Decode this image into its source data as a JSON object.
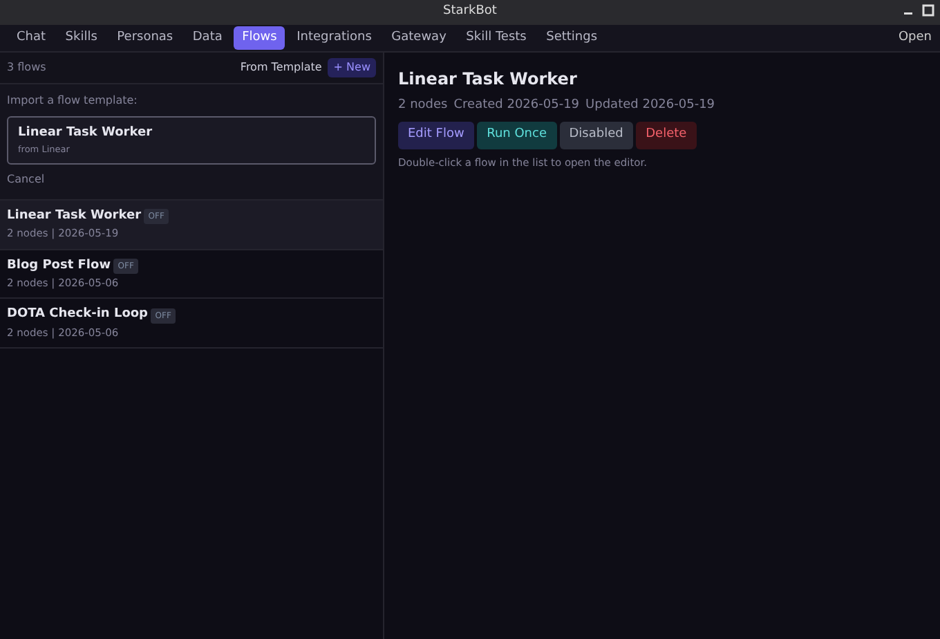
{
  "window": {
    "title": "StarkBot"
  },
  "tabs": [
    {
      "label": "Chat",
      "selected": false
    },
    {
      "label": "Skills",
      "selected": false
    },
    {
      "label": "Personas",
      "selected": false
    },
    {
      "label": "Data",
      "selected": false
    },
    {
      "label": "Flows",
      "selected": true
    },
    {
      "label": "Integrations",
      "selected": false
    },
    {
      "label": "Gateway",
      "selected": false
    },
    {
      "label": "Skill Tests",
      "selected": false
    },
    {
      "label": "Settings",
      "selected": false
    }
  ],
  "nav_right": "Open",
  "sidebar": {
    "count": "3 flows",
    "from_template": "From Template",
    "new_button": "+ New",
    "import": {
      "label": "Import a flow template:",
      "templates": [
        {
          "name": "Linear Task Worker",
          "source": "from Linear"
        }
      ],
      "cancel": "Cancel"
    },
    "flows": [
      {
        "name": "Linear Task Worker",
        "status": "OFF",
        "meta": "2 nodes | 2026-05-19",
        "selected": true
      },
      {
        "name": "Blog Post Flow",
        "status": "OFF",
        "meta": "2 nodes | 2026-05-06",
        "selected": false
      },
      {
        "name": "DOTA Check-in Loop",
        "status": "OFF",
        "meta": "2 nodes | 2026-05-06",
        "selected": false
      }
    ]
  },
  "detail": {
    "title": "Linear Task Worker",
    "nodes": "2 nodes",
    "created": "Created 2026-05-19",
    "updated": "Updated 2026-05-19",
    "buttons": [
      {
        "label": "Edit Flow",
        "kind": "edit"
      },
      {
        "label": "Run Once",
        "kind": "run"
      },
      {
        "label": "Disabled",
        "kind": "toggle"
      },
      {
        "label": "Delete",
        "kind": "delete"
      }
    ],
    "hint": "Double-click a flow in the list to open the editor."
  }
}
